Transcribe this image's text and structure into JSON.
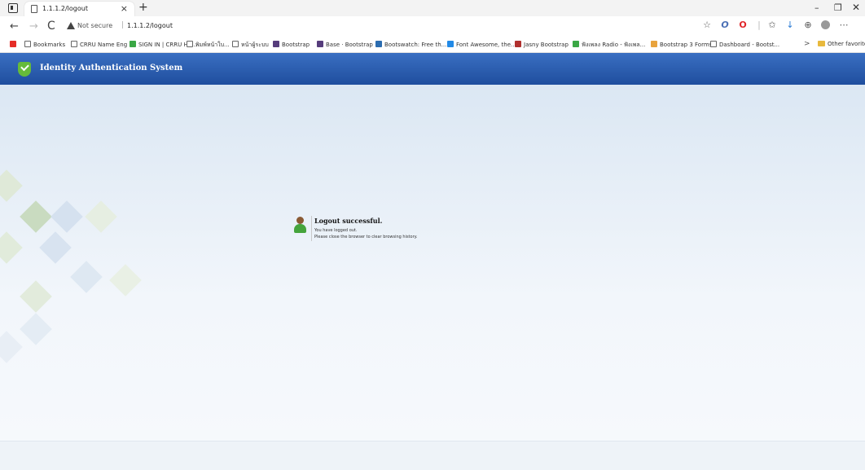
{
  "browser": {
    "tab_title": "1.1.1.2/logout",
    "tab_close": "×",
    "new_tab": "+",
    "window_controls": {
      "minimize": "–",
      "restore": "❐",
      "close": "✕"
    },
    "nav": {
      "back": "←",
      "forward": "→",
      "reload": "C"
    },
    "security_label": "Not secure",
    "url": "1.1.1.2/logout",
    "toolbar_icons": [
      "read-aloud-icon",
      "opera-icon",
      "opera-red-icon",
      "favorites-icon",
      "extension-icon",
      "collections-icon",
      "profile-icon",
      "menu-icon"
    ],
    "bookmarks": [
      {
        "label": "",
        "icon": "youtube-icon",
        "color": "#e52d27"
      },
      {
        "label": "Bookmarks",
        "icon": "page-icon"
      },
      {
        "label": "CRRU Name Eng",
        "icon": "page-icon"
      },
      {
        "label": "SIGN IN | CRRU HR...",
        "icon": "arrow-icon",
        "color": "#3aa745"
      },
      {
        "label": "พิมพ์หน้าใบ...",
        "icon": "page-icon"
      },
      {
        "label": "หน้าผู้ระบบ",
        "icon": "page-icon"
      },
      {
        "label": "Bootstrap",
        "icon": "bootstrap-icon",
        "color": "#563d7c"
      },
      {
        "label": "Base · Bootstrap",
        "icon": "bootstrap-icon",
        "color": "#563d7c"
      },
      {
        "label": "Bootswatch: Free th...",
        "icon": "bootswatch-icon",
        "color": "#2b6cb0"
      },
      {
        "label": "Font Awesome, the...",
        "icon": "fontawesome-icon",
        "color": "#228ae6"
      },
      {
        "label": "Jasny Bootstrap",
        "icon": "jasny-icon",
        "color": "#b0302e"
      },
      {
        "label": "ฟังเพลง Radio - ฟังเพล...",
        "icon": "radio-icon",
        "color": "#3aa745"
      },
      {
        "label": "Bootstrap 3 Forms",
        "icon": "forms-icon",
        "color": "#e8a33d"
      },
      {
        "label": "Dashboard - Bootst...",
        "icon": "page-icon"
      }
    ],
    "bookmarks_more": ">",
    "other_favorites": "Other favorites"
  },
  "app": {
    "title": "Identity Authentication System",
    "accent_color": "#2a5db0",
    "shield_color": "#66bb3a"
  },
  "message": {
    "title": "Logout successful.",
    "line1": "You have logged out.",
    "line2": "Please close the browser to clear browsing history."
  }
}
